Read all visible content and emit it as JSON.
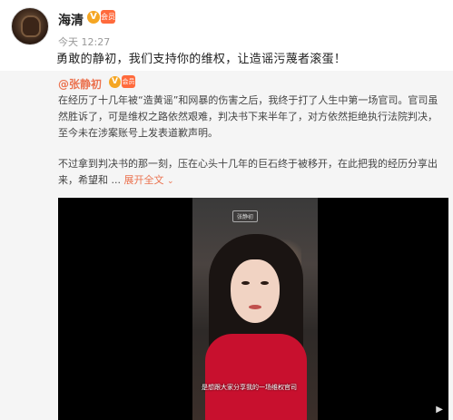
{
  "post": {
    "author": "海清",
    "time": "今天 12:27",
    "text": "勇敢的静初，我们支持你的维权，让造谣污蔑者滚蛋！"
  },
  "repost": {
    "author": "@张静初",
    "paragraph1": "在经历了十几年被“造黄谣”和网暴的伤害之后，我终于打了人生中第一场官司。官司虽然胜诉了，可是维权之路依然艰难，判决书下来半年了，对方依然拒绝执行法院判决，至今未在涉案账号上发表道歉声明。",
    "paragraph2": "不过拿到判决书的那一刻，压在心头十几年的巨石终于被移开，在此把我的经历分享出来，希望和 ...",
    "expand_label": "展开全文",
    "video": {
      "watermark": "张静初",
      "subtitle": "是想跟大家分享我的一场维权官司"
    }
  },
  "badges": {
    "v_label": "V",
    "vip_label": "会员"
  }
}
